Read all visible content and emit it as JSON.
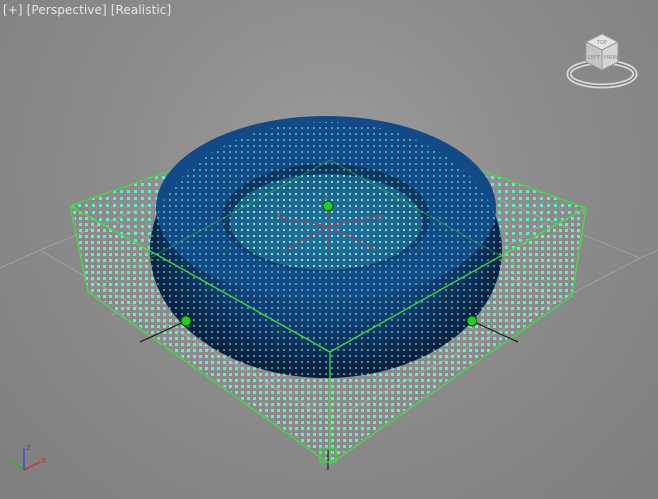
{
  "viewport": {
    "labels": {
      "plus": "[+]",
      "view": "[Perspective]",
      "shading": "[Realistic]"
    },
    "background_color": "#8c8c8c"
  },
  "viewcube": {
    "face_top": "TOP",
    "face_front": "FRONT",
    "face_left": "LEFT"
  },
  "axis_tripod": {
    "x": "x",
    "y": "y",
    "z": "z"
  },
  "gizmo_axes": {
    "x": "x",
    "y": "y",
    "z": "z"
  },
  "scene": {
    "torus_color": "#0e3f75",
    "particle_color": "#5ff0cc",
    "bounding_box_color": "#3fe03f",
    "grid_color": "#a9a9a9",
    "handle_color": "#22cc22"
  }
}
